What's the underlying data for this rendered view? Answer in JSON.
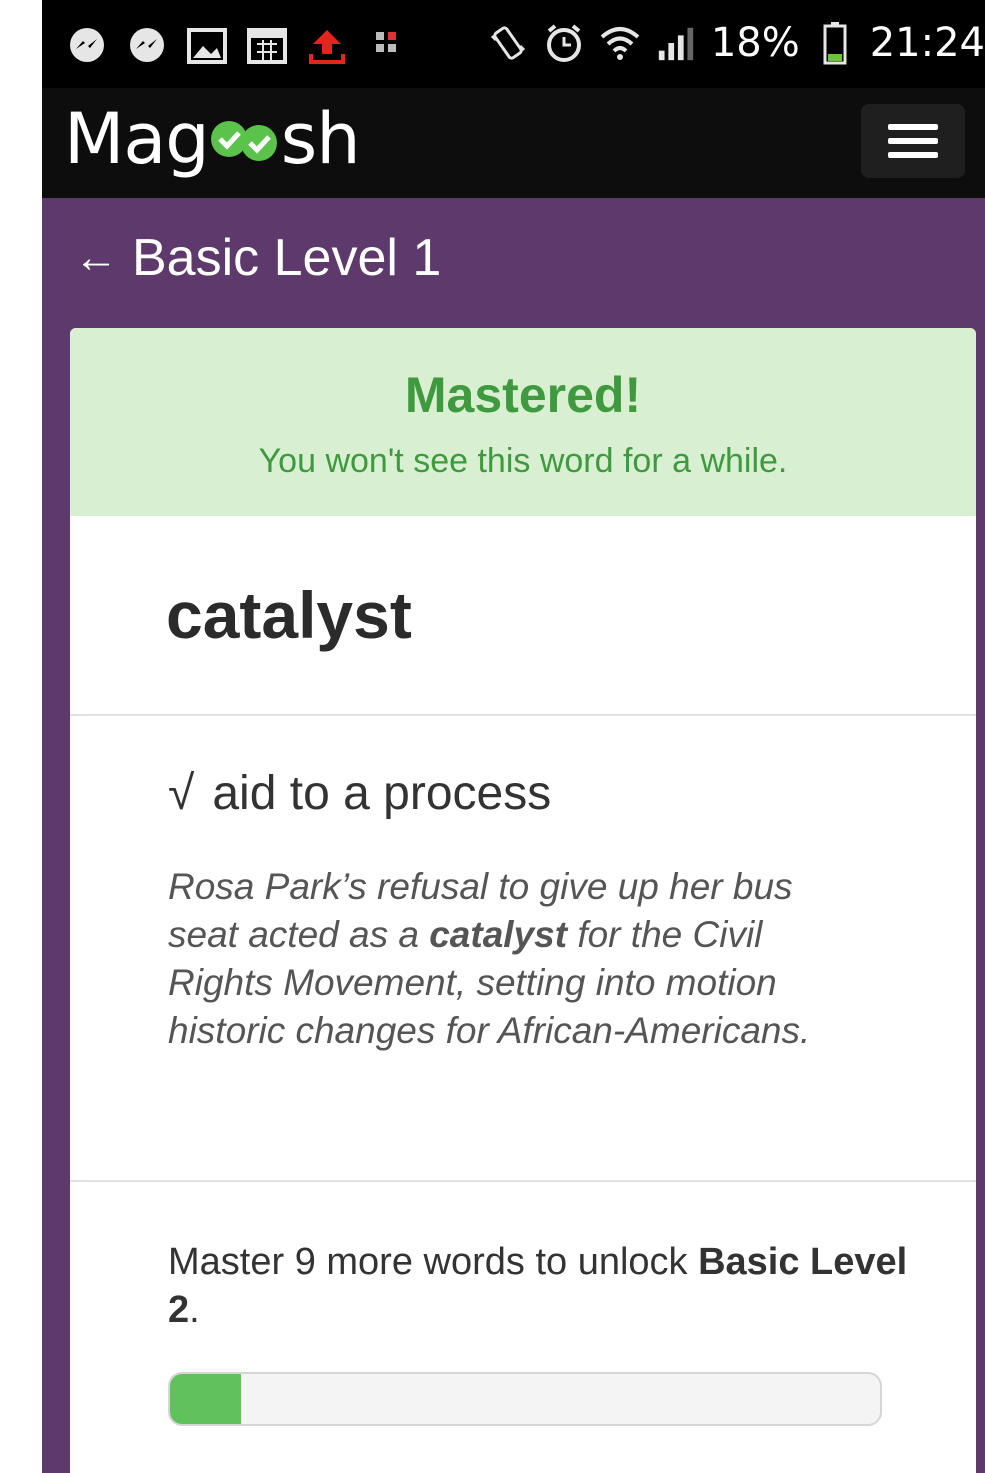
{
  "status_bar": {
    "battery_percent": "18%",
    "time": "21:24",
    "icons": [
      "messenger-icon",
      "messenger-icon",
      "image-icon",
      "calendar-icon",
      "upload-icon",
      "sim-icon",
      "vibrate-icon",
      "alarm-icon",
      "wifi-icon",
      "signal-icon",
      "battery-icon"
    ]
  },
  "header": {
    "logo_prefix": "Mag",
    "logo_suffix": "sh",
    "menu_icon": "hamburger-menu-icon"
  },
  "nav": {
    "back_arrow": "←",
    "title": "Basic Level 1"
  },
  "banner": {
    "title": "Mastered!",
    "subtitle": "You won't see this word for a while."
  },
  "card": {
    "word": "catalyst",
    "check_mark": "√",
    "definition": "aid to a process",
    "example_before": "Rosa Park’s refusal to give up her bus seat acted as a ",
    "example_word": "catalyst",
    "example_after": " for the Civil Rights Movement, setting into motion historic changes for African-Americans."
  },
  "progress": {
    "msg_before": "Master 9 more words to unlock ",
    "msg_bold": "Basic Level 2",
    "msg_after": ".",
    "fraction": 0.1
  },
  "colors": {
    "purple_background": "#5d3a6b",
    "banner_green_bg": "#d9efd2",
    "banner_green_text": "#3f9a3f",
    "progress_green": "#5fc25c"
  }
}
